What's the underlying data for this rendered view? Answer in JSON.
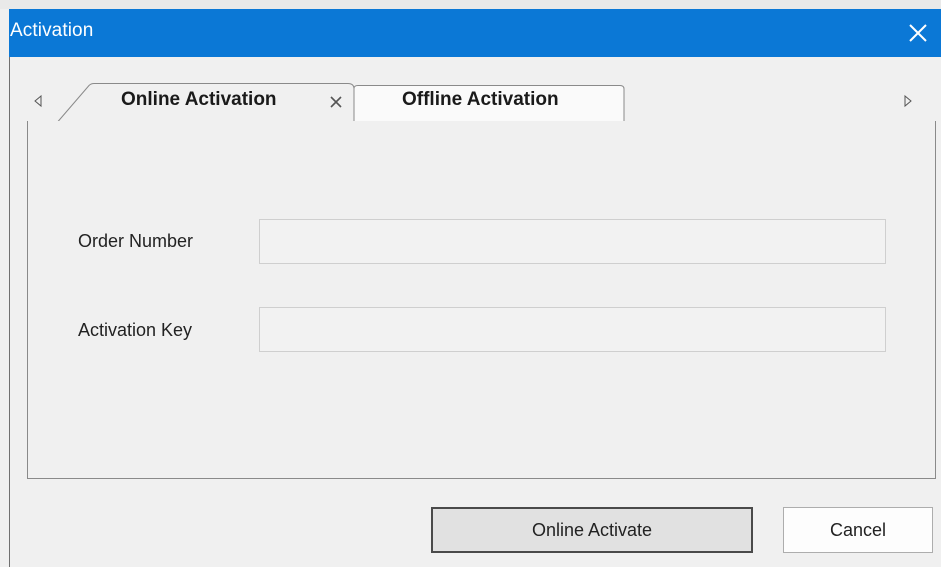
{
  "window": {
    "title": "Activation",
    "close_icon": "close-icon",
    "title_bar_color": "#0b78d6"
  },
  "tabs": {
    "scroll_left_icon": "triangle-left-icon",
    "scroll_right_icon": "triangle-right-icon",
    "items": [
      {
        "label": "Online Activation",
        "active": true,
        "closable": true
      },
      {
        "label": "Offline Activation",
        "active": false,
        "closable": false
      }
    ]
  },
  "form": {
    "order_number": {
      "label": "Order Number",
      "value": "",
      "placeholder": ""
    },
    "activation_key": {
      "label": "Activation Key",
      "value": "",
      "placeholder": ""
    }
  },
  "buttons": {
    "activate_label": "Online Activate",
    "cancel_label": "Cancel"
  }
}
